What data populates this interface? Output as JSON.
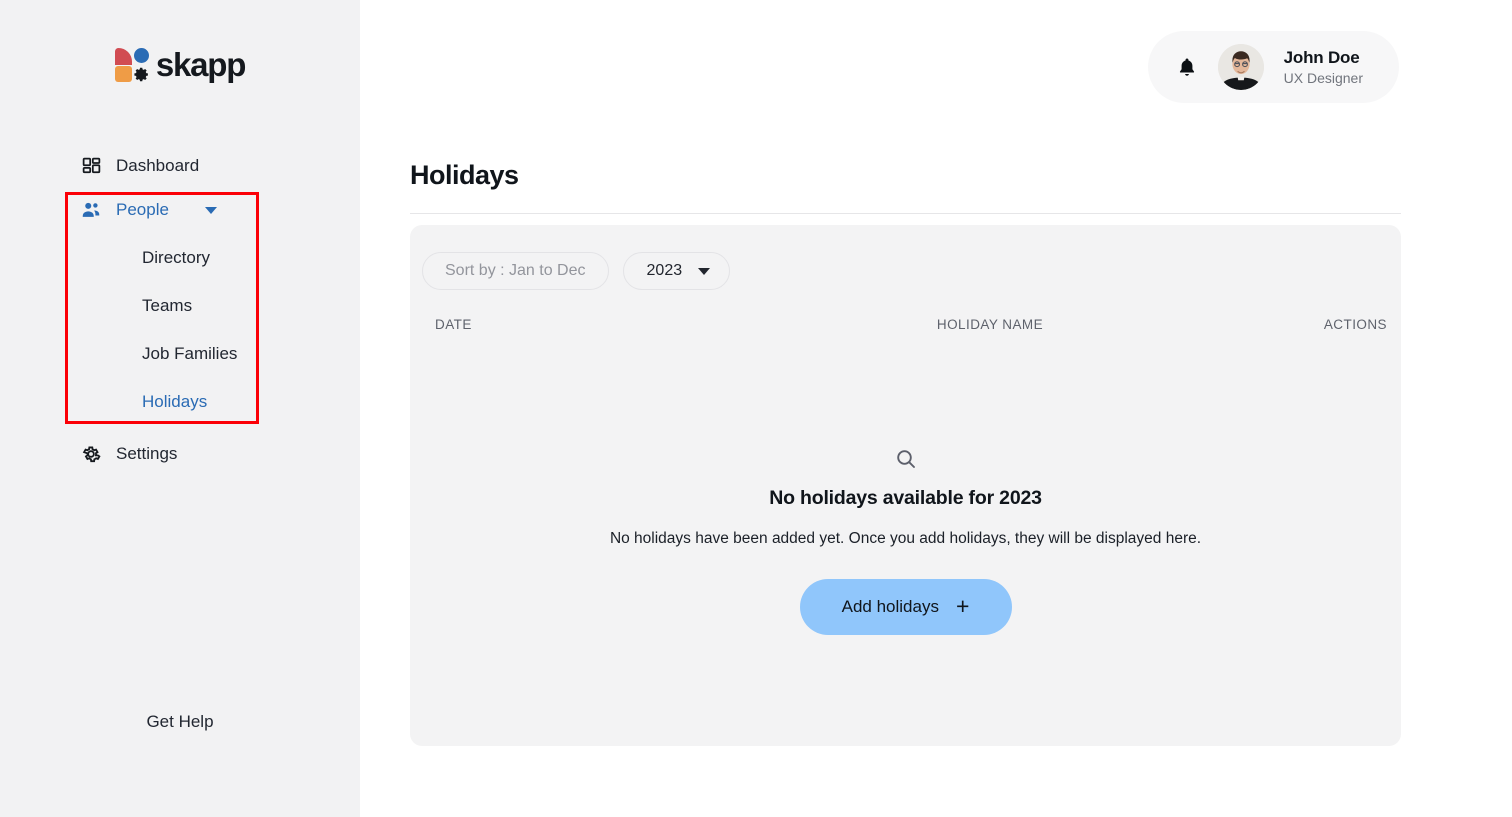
{
  "app": {
    "brand_name": "skapp",
    "colors": {
      "accent_blue": "#2a6bb4",
      "button_blue": "#90c6fb",
      "annotation_red": "#fb0007",
      "sidebar_bg": "#f2f2f3",
      "card_bg": "#f3f3f4"
    }
  },
  "sidebar": {
    "items": [
      {
        "label": "Dashboard",
        "icon": "dashboard-grid-icon",
        "active": false
      },
      {
        "label": "People",
        "icon": "people-icon",
        "active": true,
        "expanded": true
      },
      {
        "label": "Settings",
        "icon": "gear-icon",
        "active": false
      }
    ],
    "people_subitems": [
      {
        "label": "Directory",
        "active": false
      },
      {
        "label": "Teams",
        "active": false
      },
      {
        "label": "Job Families",
        "active": false
      },
      {
        "label": "Holidays",
        "active": true
      }
    ],
    "get_help_label": "Get Help"
  },
  "header": {
    "notification_icon": "bell-icon",
    "user": {
      "name": "John Doe",
      "role": "UX Designer",
      "avatar_alt": "avatar"
    }
  },
  "main": {
    "page_title": "Holidays",
    "filters": {
      "sort_label": "Sort by : Jan to Dec",
      "year_label": "2023",
      "year_caret_icon": "chevron-down-icon"
    },
    "table": {
      "columns": [
        "DATE",
        "HOLIDAY NAME",
        "ACTIONS"
      ],
      "rows": []
    },
    "empty_state": {
      "icon": "search-icon",
      "title": "No holidays available for 2023",
      "description": "No holidays have been added yet. Once you add holidays, they will be displayed here.",
      "button_label": "Add holidays",
      "button_plus_icon": "plus-icon",
      "button_plus_glyph": "+"
    }
  }
}
